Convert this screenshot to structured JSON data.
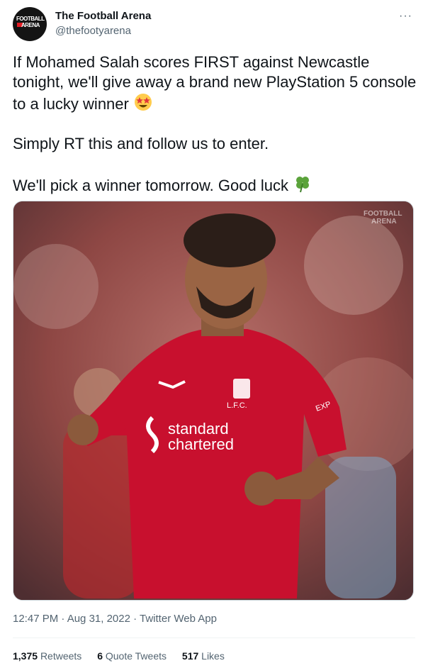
{
  "account": {
    "display_name": "The Football Arena",
    "handle": "@thefootyarena",
    "avatar_text_line1": "FOOTBALL",
    "avatar_text_line2": "ARENA",
    "more_label": "···"
  },
  "tweet": {
    "line1": "If Mohamed Salah scores FIRST against Newcastle tonight, we'll give away a brand new PlayStation 5 console to a lucky winner",
    "line2": "Simply RT this and follow us to enter.",
    "line3": "We'll pick a winner tomorrow. Good luck"
  },
  "media": {
    "watermark_line1": "FOOTBALL",
    "watermark_line2": "ARENA",
    "sponsor_line1": "standard",
    "sponsor_line2": "chartered",
    "crest_text": "L.F.C.",
    "sleeve_text": "EXP"
  },
  "meta": {
    "timestamp": "12:47 PM · Aug 31, 2022 · Twitter Web App"
  },
  "stats": {
    "retweets_count": "1,375",
    "retweets_label": "Retweets",
    "quotes_count": "6",
    "quotes_label": "Quote Tweets",
    "likes_count": "517",
    "likes_label": "Likes"
  },
  "colors": {
    "jersey_red": "#c8102e",
    "text_primary": "#0f1419",
    "text_secondary": "#536471"
  },
  "icons": [
    "star-struck-emoji",
    "four-leaf-clover-emoji",
    "more-options-icon"
  ]
}
